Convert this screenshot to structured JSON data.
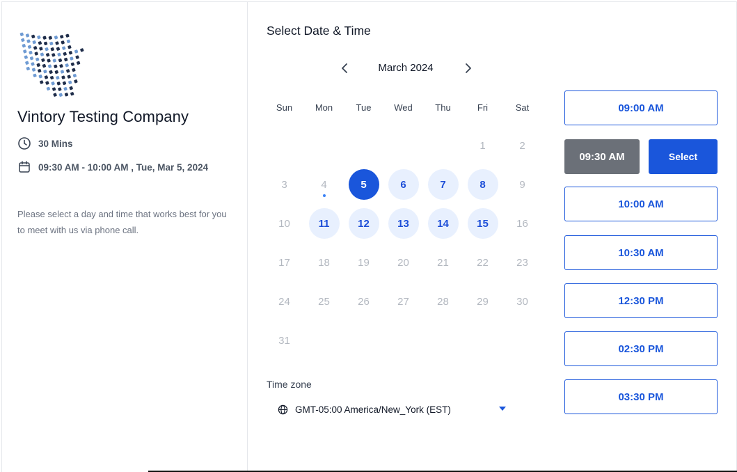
{
  "company": {
    "name": "Vintory Testing Company",
    "duration": "30 Mins",
    "datetime": "09:30 AM - 10:00 AM , Tue, Mar 5, 2024",
    "description": "Please select a day and time that works best for you to meet with us via phone call."
  },
  "calendar": {
    "title": "Select Date & Time",
    "month": "March 2024",
    "weekdays": [
      "Sun",
      "Mon",
      "Tue",
      "Wed",
      "Thu",
      "Fri",
      "Sat"
    ],
    "days": [
      {
        "d": "1",
        "state": "disabled"
      },
      {
        "d": "2",
        "state": "disabled"
      },
      {
        "d": "3",
        "state": "disabled"
      },
      {
        "d": "4",
        "state": "today"
      },
      {
        "d": "5",
        "state": "selected"
      },
      {
        "d": "6",
        "state": "available"
      },
      {
        "d": "7",
        "state": "available"
      },
      {
        "d": "8",
        "state": "available"
      },
      {
        "d": "9",
        "state": "disabled"
      },
      {
        "d": "10",
        "state": "disabled"
      },
      {
        "d": "11",
        "state": "available"
      },
      {
        "d": "12",
        "state": "available"
      },
      {
        "d": "13",
        "state": "available"
      },
      {
        "d": "14",
        "state": "available"
      },
      {
        "d": "15",
        "state": "available"
      },
      {
        "d": "16",
        "state": "disabled"
      },
      {
        "d": "17",
        "state": "disabled"
      },
      {
        "d": "18",
        "state": "disabled"
      },
      {
        "d": "19",
        "state": "disabled"
      },
      {
        "d": "20",
        "state": "disabled"
      },
      {
        "d": "21",
        "state": "disabled"
      },
      {
        "d": "22",
        "state": "disabled"
      },
      {
        "d": "23",
        "state": "disabled"
      },
      {
        "d": "24",
        "state": "disabled"
      },
      {
        "d": "25",
        "state": "disabled"
      },
      {
        "d": "26",
        "state": "disabled"
      },
      {
        "d": "27",
        "state": "disabled"
      },
      {
        "d": "28",
        "state": "disabled"
      },
      {
        "d": "29",
        "state": "disabled"
      },
      {
        "d": "30",
        "state": "disabled"
      },
      {
        "d": "31",
        "state": "disabled"
      }
    ]
  },
  "timezone": {
    "label": "Time zone",
    "value": "GMT-05:00 America/New_York (EST)"
  },
  "slots": {
    "list": [
      "09:00 AM",
      "10:00 AM",
      "10:30 AM",
      "12:30 PM",
      "02:30 PM",
      "03:30 PM"
    ],
    "selected": "09:30 AM",
    "select_label": "Select"
  },
  "colors": {
    "accent": "#1a56db",
    "available_bg": "#e8f0fe",
    "selected_slot_bg": "#6b7078",
    "disabled_text": "#b3b8c0"
  },
  "icons": {
    "logo": "company-logo",
    "duration": "clock-icon",
    "date": "calendar-icon",
    "prev": "chevron-left-icon",
    "next": "chevron-right-icon",
    "timezone": "globe-icon",
    "dropdown": "caret-down-icon"
  }
}
